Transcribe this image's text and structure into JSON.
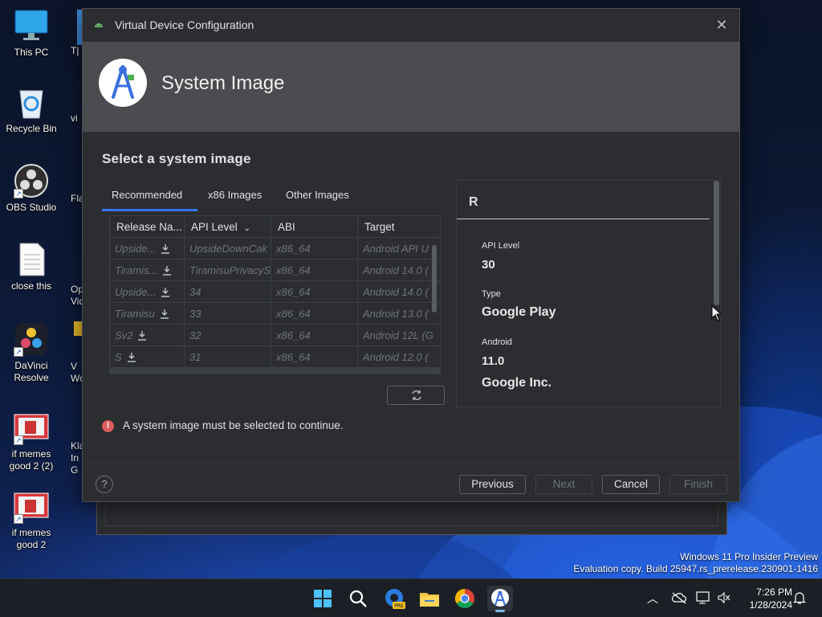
{
  "desktop": {
    "icons": [
      {
        "label": "This PC",
        "icon": "monitor-icon"
      },
      {
        "label": "Recycle Bin",
        "icon": "recycle-bin-icon"
      },
      {
        "label": "OBS Studio",
        "icon": "obs-icon"
      },
      {
        "label": "close this",
        "icon": "text-file-icon"
      },
      {
        "label": "DaVinci Resolve",
        "icon": "davinci-resolve-icon"
      },
      {
        "label": "if memes good 2 (2)",
        "icon": "image-file-icon"
      },
      {
        "label": "if memes good 2",
        "icon": "image-file-icon"
      }
    ],
    "partial_labels": [
      "T| S|",
      "vi",
      "Fla",
      "Op Vid",
      "V Wo",
      "Klas In G"
    ]
  },
  "dialog": {
    "title": "Virtual Device Configuration",
    "header_title": "System Image",
    "section_title": "Select a system image",
    "tabs": [
      "Recommended",
      "x86 Images",
      "Other Images"
    ],
    "active_tab": "Recommended",
    "table": {
      "columns": [
        "Release Na...",
        "API Level",
        "ABI",
        "Target"
      ],
      "rows": [
        {
          "release": "Upside...",
          "api": "UpsideDownCak",
          "abi": "x86_64",
          "target": "Android API U"
        },
        {
          "release": "Tiramis...",
          "api": "TiramisuPrivacyS",
          "abi": "x86_64",
          "target": "Android 14.0 ("
        },
        {
          "release": "Upside...",
          "api": "34",
          "abi": "x86_64",
          "target": "Android 14.0 ("
        },
        {
          "release": "Tiramisu",
          "api": "33",
          "abi": "x86_64",
          "target": "Android 13.0 ("
        },
        {
          "release": "Sv2",
          "api": "32",
          "abi": "x86_64",
          "target": "Android 12L (G"
        },
        {
          "release": "S",
          "api": "31",
          "abi": "x86_64",
          "target": "Android 12.0 ("
        }
      ]
    },
    "detail": {
      "name": "R",
      "api_level_label": "API Level",
      "api_level": "30",
      "type_label": "Type",
      "type": "Google Play",
      "android_label": "Android",
      "android_version": "11.0",
      "vendor": "Google Inc."
    },
    "error_text": "A system image must be selected to continue.",
    "buttons": {
      "help": "?",
      "previous": "Previous",
      "next": "Next",
      "cancel": "Cancel",
      "finish": "Finish"
    }
  },
  "watermark": {
    "line1": "Windows 11 Pro Insider Preview",
    "line2": "Evaluation copy. Build 25947.rs_prerelease.230901-1416"
  },
  "taskbar": {
    "icons": [
      "start-icon",
      "search-icon",
      "edge-beta-icon",
      "file-explorer-icon",
      "chrome-icon",
      "android-studio-icon"
    ],
    "time": "7:26 PM",
    "date": "1/28/2024"
  }
}
